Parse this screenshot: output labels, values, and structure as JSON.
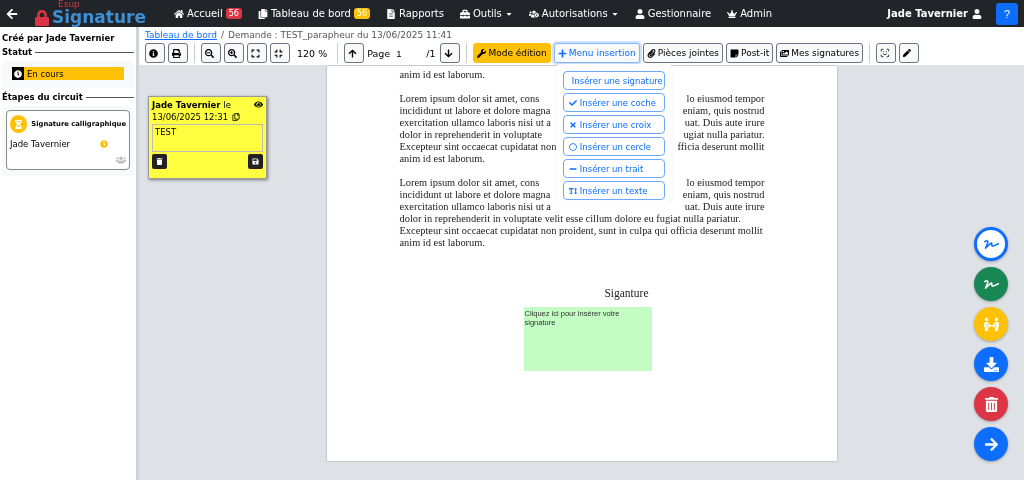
{
  "navbar": {
    "logo_small": "Esup",
    "logo": "Signature",
    "items": [
      {
        "label": "Accueil",
        "kind": "link",
        "badge": {
          "text": "56",
          "color": "#dc3545"
        }
      },
      {
        "label": "Tableau de bord",
        "kind": "link",
        "badge": {
          "text": "56",
          "color": "#ffc107"
        }
      },
      {
        "label": "Rapports",
        "kind": "link"
      },
      {
        "label": "Outils",
        "kind": "dropdown"
      },
      {
        "label": "Autorisations",
        "kind": "dropdown"
      },
      {
        "label": "Gestionnaire",
        "kind": "link"
      },
      {
        "label": "Admin",
        "kind": "link"
      }
    ],
    "user": "Jade Tavernier",
    "help": "?"
  },
  "sidebar": {
    "created_by": "Créé par Jade Tavernier",
    "status_heading": "Statut",
    "status": "En cours",
    "steps_heading": "Étapes du circuit",
    "steps": [
      {
        "title": "Signature calligraphique",
        "signer": "Jade Tavernier"
      }
    ]
  },
  "breadcrumb": {
    "link": "Tableau de bord",
    "separator": "/",
    "current": "Demande : TEST_parapheur du 13/06/2025 11:41"
  },
  "toolbar": {
    "zoom": "120 %",
    "page_label": "Page",
    "page_value": "1",
    "page_total": "/1",
    "buttons": [
      {
        "label": "Mode édition",
        "kind": "edit"
      },
      {
        "label": "Menu insertion",
        "kind": "menu"
      },
      {
        "label": "Pièces jointes",
        "kind": "plain"
      },
      {
        "label": "Post-it",
        "kind": "plain"
      },
      {
        "label": "Mes signatures",
        "kind": "plain"
      }
    ]
  },
  "insert_menu": [
    "Insérer une signature",
    "Insérer une coche",
    "Insérer une croix",
    "Insérer un cercle",
    "Insérer un trait",
    "Insérer un texte"
  ],
  "postit": {
    "author": "Jade Tavernier",
    "suffix": "le",
    "date": "13/06/2025 12:31",
    "text": "TEST"
  },
  "document": {
    "paragraphs": [
      [
        {
          "left": "anim id est laborum."
        }
      ],
      [
        {
          "left": "Lorem ipsum dolor sit amet, cons",
          "right": "lo eiusmod tempor"
        },
        {
          "left": "incididunt ut labore et dolore magna",
          "right": "eniam, quis nostrud"
        },
        {
          "left": "exercitation ullamco laboris nisi ut a",
          "right": "uat. Duis aute irure"
        },
        {
          "left": "dolor in reprehenderit in voluptate",
          "right": "ugiat nulla pariatur."
        },
        {
          "left": "Excepteur sint occaecat cupidatat non",
          "right": "fficia deserunt mollit"
        },
        {
          "left": "anim id est laborum."
        }
      ],
      [
        {
          "left": "Lorem ipsum dolor sit amet, cons",
          "right": "lo eiusmod tempor"
        },
        {
          "left": "incididunt ut labore et dolore magna",
          "right": "eniam, quis nostrud"
        },
        {
          "left": "exercitation ullamco laboris nisi ut a",
          "right": "uat. Duis aute irure"
        },
        {
          "left": "dolor in reprehenderit in voluptate velit esse cillum dolore eu fugiat nulla pariatur."
        },
        {
          "left": "Excepteur sint occaecat cupidatat non proident, sunt in culpa qui officia deserunt mollit"
        },
        {
          "left": "anim id est laborum."
        }
      ]
    ],
    "signature_heading": "Siganture",
    "signature_field": "Cliquez ici pour insérer votre signature"
  },
  "actions": [
    {
      "color": "#ffffff"
    },
    {
      "color": "#198754"
    },
    {
      "color": "#ffc107"
    },
    {
      "color": "#0d6efd"
    },
    {
      "color": "#dc3545"
    },
    {
      "color": "#0d6efd"
    }
  ]
}
